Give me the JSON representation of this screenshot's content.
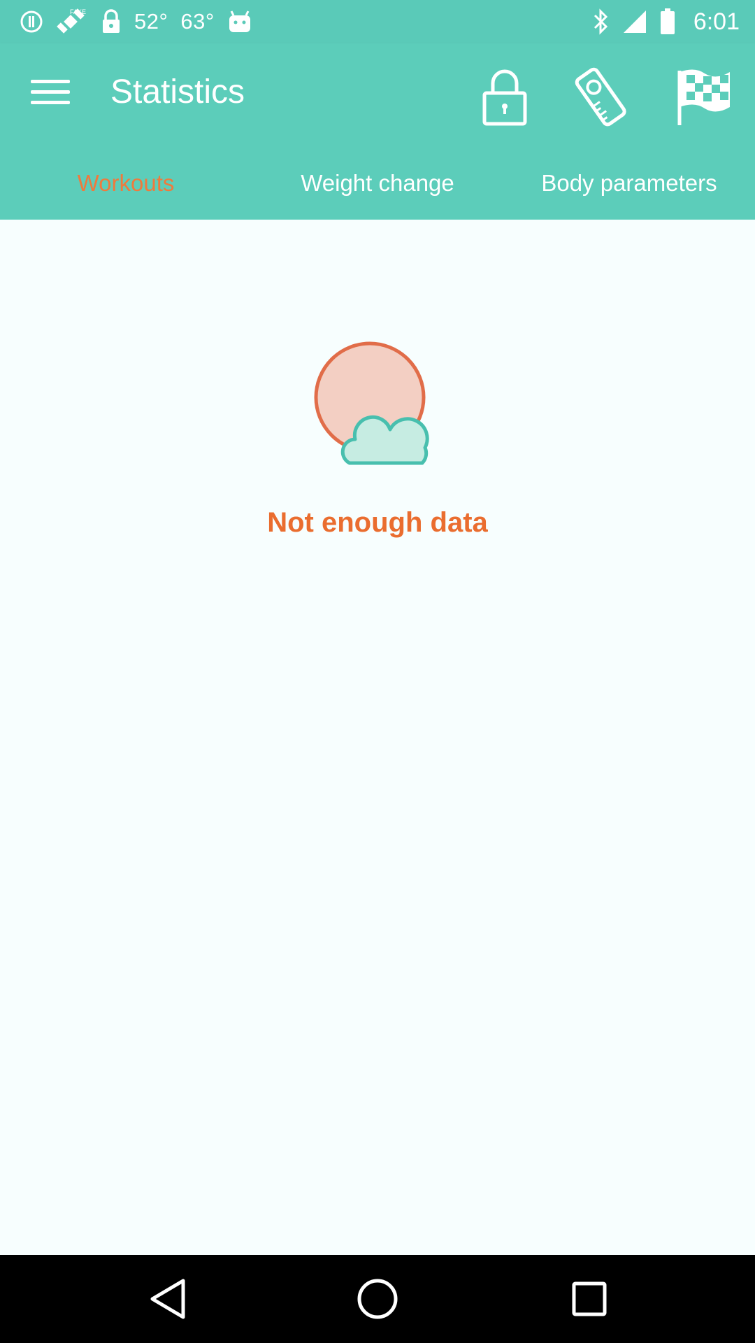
{
  "status_bar": {
    "temp1": "52°",
    "temp2": "63°",
    "time": "6:01"
  },
  "app_bar": {
    "title": "Statistics"
  },
  "tabs": [
    {
      "label": "Workouts",
      "active": true
    },
    {
      "label": "Weight change",
      "active": false
    },
    {
      "label": "Body parameters",
      "active": false
    }
  ],
  "empty_state": {
    "message": "Not enough data"
  },
  "colors": {
    "primary": "#5ccdba",
    "accent": "#ef7a3d",
    "background": "#f7fefe"
  },
  "icons": [
    "menu-icon",
    "lock-icon",
    "measuring-tape-icon",
    "checkered-flag-icon",
    "sun-cloud-icon"
  ]
}
